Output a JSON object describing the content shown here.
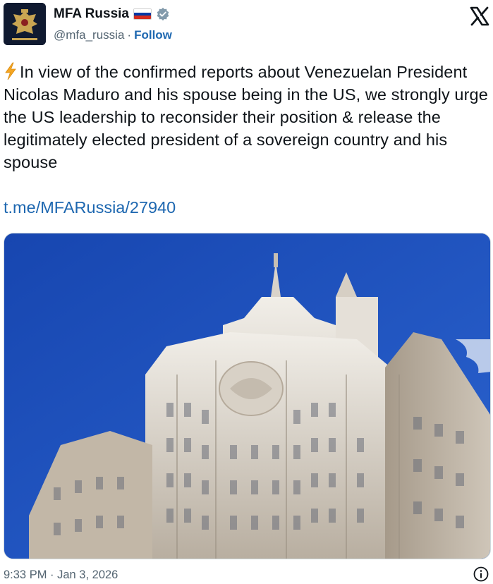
{
  "account": {
    "name": "MFA Russia",
    "handle": "@mfa_russia",
    "separator": "·",
    "follow_label": "Follow",
    "avatar_icon": "russian-eagle-emblem",
    "flag_icon": "russia-flag",
    "verified_icon": "verified-badge"
  },
  "tweet": {
    "text": "In view of the confirmed reports about Venezuelan President Nicolas Maduro and his spouse being in the US, we strongly urge the US leadership to reconsider their position & release the legitimately elected president of a sovereign country and his spouse",
    "lead_icon": "lightning-bolt-emoji",
    "link": "t.me/MFARussia/27940",
    "media_alt": "photo of the Russian Ministry of Foreign Affairs building against a blue sky"
  },
  "footer": {
    "timestamp": "9:33 PM · Jan 3, 2026",
    "info_icon": "info-icon"
  },
  "colors": {
    "text": "#0f1419",
    "secondary": "#536471",
    "link": "#1d67b0",
    "sky": "#1a4fb5"
  }
}
